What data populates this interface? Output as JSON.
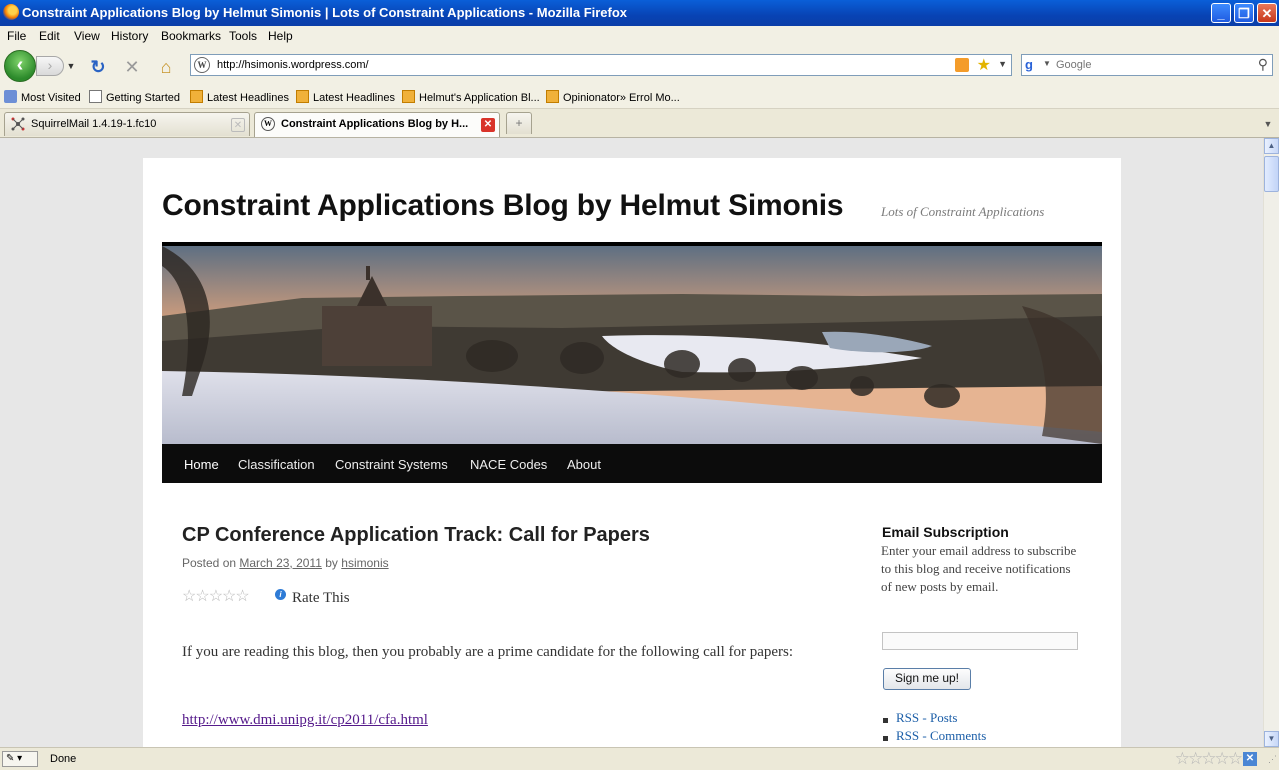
{
  "window": {
    "title": "Constraint Applications Blog by Helmut Simonis | Lots of Constraint Applications - Mozilla Firefox",
    "controls": {
      "minimize": "_",
      "maximize": "❐",
      "close": "✕"
    }
  },
  "menubar": [
    "File",
    "Edit",
    "View",
    "History",
    "Bookmarks",
    "Tools",
    "Help"
  ],
  "navbar": {
    "url": "http://hsimonis.wordpress.com/",
    "search_placeholder": "Google"
  },
  "bookmarks": [
    {
      "label": "Most Visited",
      "icon": "most-visited-icon"
    },
    {
      "label": "Getting Started",
      "icon": "page-icon"
    },
    {
      "label": "Latest Headlines",
      "icon": "rss-icon"
    },
    {
      "label": "Latest Headlines",
      "icon": "rss-icon"
    },
    {
      "label": "Helmut's Application Bl...",
      "icon": "rss-icon"
    },
    {
      "label": "Opinionator» Errol Mo...",
      "icon": "rss-icon"
    }
  ],
  "tabs": [
    {
      "label": "SquirrelMail 1.4.19-1.fc10",
      "active": false
    },
    {
      "label": "Constraint Applications Blog by H...",
      "active": true
    }
  ],
  "page": {
    "site_title": "Constraint Applications Blog by Helmut Simonis",
    "site_description": "Lots of Constraint Applications",
    "menu": [
      "Home",
      "Classification",
      "Constraint Systems",
      "NACE Codes",
      "About"
    ],
    "post": {
      "title": "CP Conference Application Track: Call for Papers",
      "posted_on": "Posted on",
      "date": "March 23, 2011",
      "by": "by",
      "author": "hsimonis",
      "rate_label": "Rate This",
      "rating": 0,
      "rating_max": 5,
      "body": "If you are reading this blog, then you probably are a prime candidate for the following call for papers:",
      "link": "http://www.dmi.unipg.it/cp2011/cfa.html"
    },
    "sidebar": {
      "widget_title": "Email Subscription",
      "widget_text": "Enter your email address to subscribe to this blog and receive notifications of new posts by email.",
      "email_value": "",
      "signup_button": "Sign me up!",
      "rss_posts": "RSS - Posts",
      "rss_comments": "RSS - Comments"
    }
  },
  "statusbar": {
    "text": "Done"
  },
  "colors": {
    "accent": "#0a5fd8",
    "menu_bg": "#0c0c0c",
    "link": "#1b5ea8",
    "visited": "#551a8b"
  }
}
